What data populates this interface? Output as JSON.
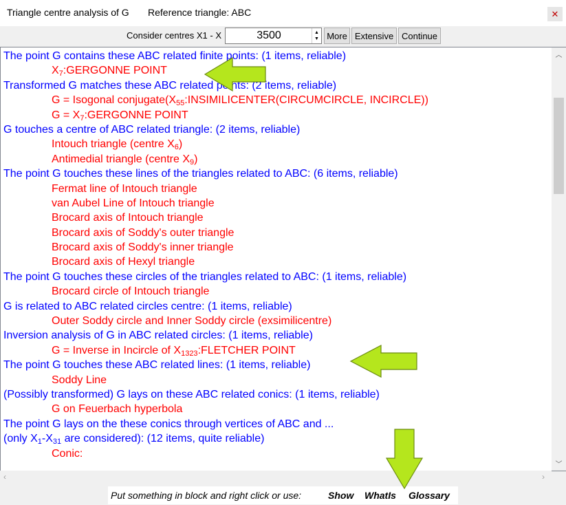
{
  "window": {
    "title": "Triangle centre analysis of G",
    "reference": "Reference triangle: ABC",
    "close_symbol": "✕"
  },
  "toolbar": {
    "consider_label": "Consider centres X1 - X",
    "spin_value": "3500",
    "more_label": "More",
    "extensive_label": "Extensive",
    "continue_label": "Continue"
  },
  "lines": [
    {
      "kind": "blue",
      "segments": [
        {
          "t": "The point G contains these ABC related finite points: (1 items, reliable)"
        }
      ]
    },
    {
      "kind": "red",
      "segments": [
        {
          "t": "X"
        },
        {
          "t": "7",
          "sub": true
        },
        {
          "t": ":GERGONNE POINT"
        }
      ]
    },
    {
      "kind": "blue",
      "segments": [
        {
          "t": "Transformed G matches these ABC related points: (2 items, reliable)"
        }
      ]
    },
    {
      "kind": "red",
      "segments": [
        {
          "t": "G = Isogonal conjugate(X"
        },
        {
          "t": "55",
          "sub": true
        },
        {
          "t": ":INSIMILICENTER(CIRCUMCIRCLE, INCIRCLE))"
        }
      ]
    },
    {
      "kind": "red",
      "segments": [
        {
          "t": "G = X"
        },
        {
          "t": "7",
          "sub": true
        },
        {
          "t": ":GERGONNE POINT"
        }
      ]
    },
    {
      "kind": "blue",
      "segments": [
        {
          "t": "G touches a centre of ABC related triangle: (2 items, reliable)"
        }
      ]
    },
    {
      "kind": "red",
      "segments": [
        {
          "t": "Intouch triangle (centre X"
        },
        {
          "t": "6",
          "sub": true
        },
        {
          "t": ")"
        }
      ]
    },
    {
      "kind": "red",
      "segments": [
        {
          "t": "Antimedial triangle (centre X"
        },
        {
          "t": "9",
          "sub": true
        },
        {
          "t": ")"
        }
      ]
    },
    {
      "kind": "blue",
      "segments": [
        {
          "t": "The point G touches these lines of the triangles related to ABC: (6 items, reliable)"
        }
      ]
    },
    {
      "kind": "red",
      "segments": [
        {
          "t": "Fermat line of Intouch triangle"
        }
      ]
    },
    {
      "kind": "red",
      "segments": [
        {
          "t": "van Aubel Line of Intouch triangle"
        }
      ]
    },
    {
      "kind": "red",
      "segments": [
        {
          "t": "Brocard axis of Intouch triangle"
        }
      ]
    },
    {
      "kind": "red",
      "segments": [
        {
          "t": "Brocard axis of Soddy's outer triangle"
        }
      ]
    },
    {
      "kind": "red",
      "segments": [
        {
          "t": "Brocard axis of Soddy's inner triangle"
        }
      ]
    },
    {
      "kind": "red",
      "segments": [
        {
          "t": "Brocard axis of Hexyl triangle"
        }
      ]
    },
    {
      "kind": "blue",
      "segments": [
        {
          "t": "The point G touches these circles of the triangles related to ABC: (1 items, reliable)"
        }
      ]
    },
    {
      "kind": "red",
      "segments": [
        {
          "t": "Brocard circle of Intouch triangle"
        }
      ]
    },
    {
      "kind": "blue",
      "segments": [
        {
          "t": "G is related to ABC related circles centre: (1 items, reliable)"
        }
      ]
    },
    {
      "kind": "red",
      "segments": [
        {
          "t": "Outer Soddy circle and Inner Soddy circle (exsimilicentre)"
        }
      ]
    },
    {
      "kind": "blue",
      "segments": [
        {
          "t": "Inversion analysis of G in ABC related circles: (1 items, reliable)"
        }
      ]
    },
    {
      "kind": "red",
      "segments": [
        {
          "t": "G = Inverse in Incircle of X"
        },
        {
          "t": "1323",
          "sub": true
        },
        {
          "t": ":FLETCHER POINT"
        }
      ]
    },
    {
      "kind": "blue",
      "segments": [
        {
          "t": "The point G touches these ABC related lines: (1 items, reliable)"
        }
      ]
    },
    {
      "kind": "red",
      "segments": [
        {
          "t": "Soddy Line"
        }
      ]
    },
    {
      "kind": "blue",
      "segments": [
        {
          "t": "(Possibly transformed) G lays on these ABC related conics: (1 items, reliable)"
        }
      ]
    },
    {
      "kind": "red",
      "segments": [
        {
          "t": "G on Feuerbach hyperbola"
        }
      ]
    },
    {
      "kind": "blue",
      "segments": [
        {
          "t": "The point G lays on the these conics through vertices of ABC and ..."
        }
      ]
    },
    {
      "kind": "blue",
      "segments": [
        {
          "t": "(only X"
        },
        {
          "t": "1",
          "sub": true
        },
        {
          "t": "-X"
        },
        {
          "t": "31",
          "sub": true
        },
        {
          "t": " are considered): (12 items, quite reliable)"
        }
      ]
    },
    {
      "kind": "red",
      "segments": [
        {
          "t": "Conic:"
        }
      ]
    }
  ],
  "bottom": {
    "prompt": "Put something in block and right click or use:",
    "show_label": "Show",
    "whatis_label": "WhatIs",
    "glossary_label": "Glossary"
  },
  "colors": {
    "heading": "#0000ff",
    "item": "#ff0000",
    "annotation_arrow": "#b5e61d"
  }
}
